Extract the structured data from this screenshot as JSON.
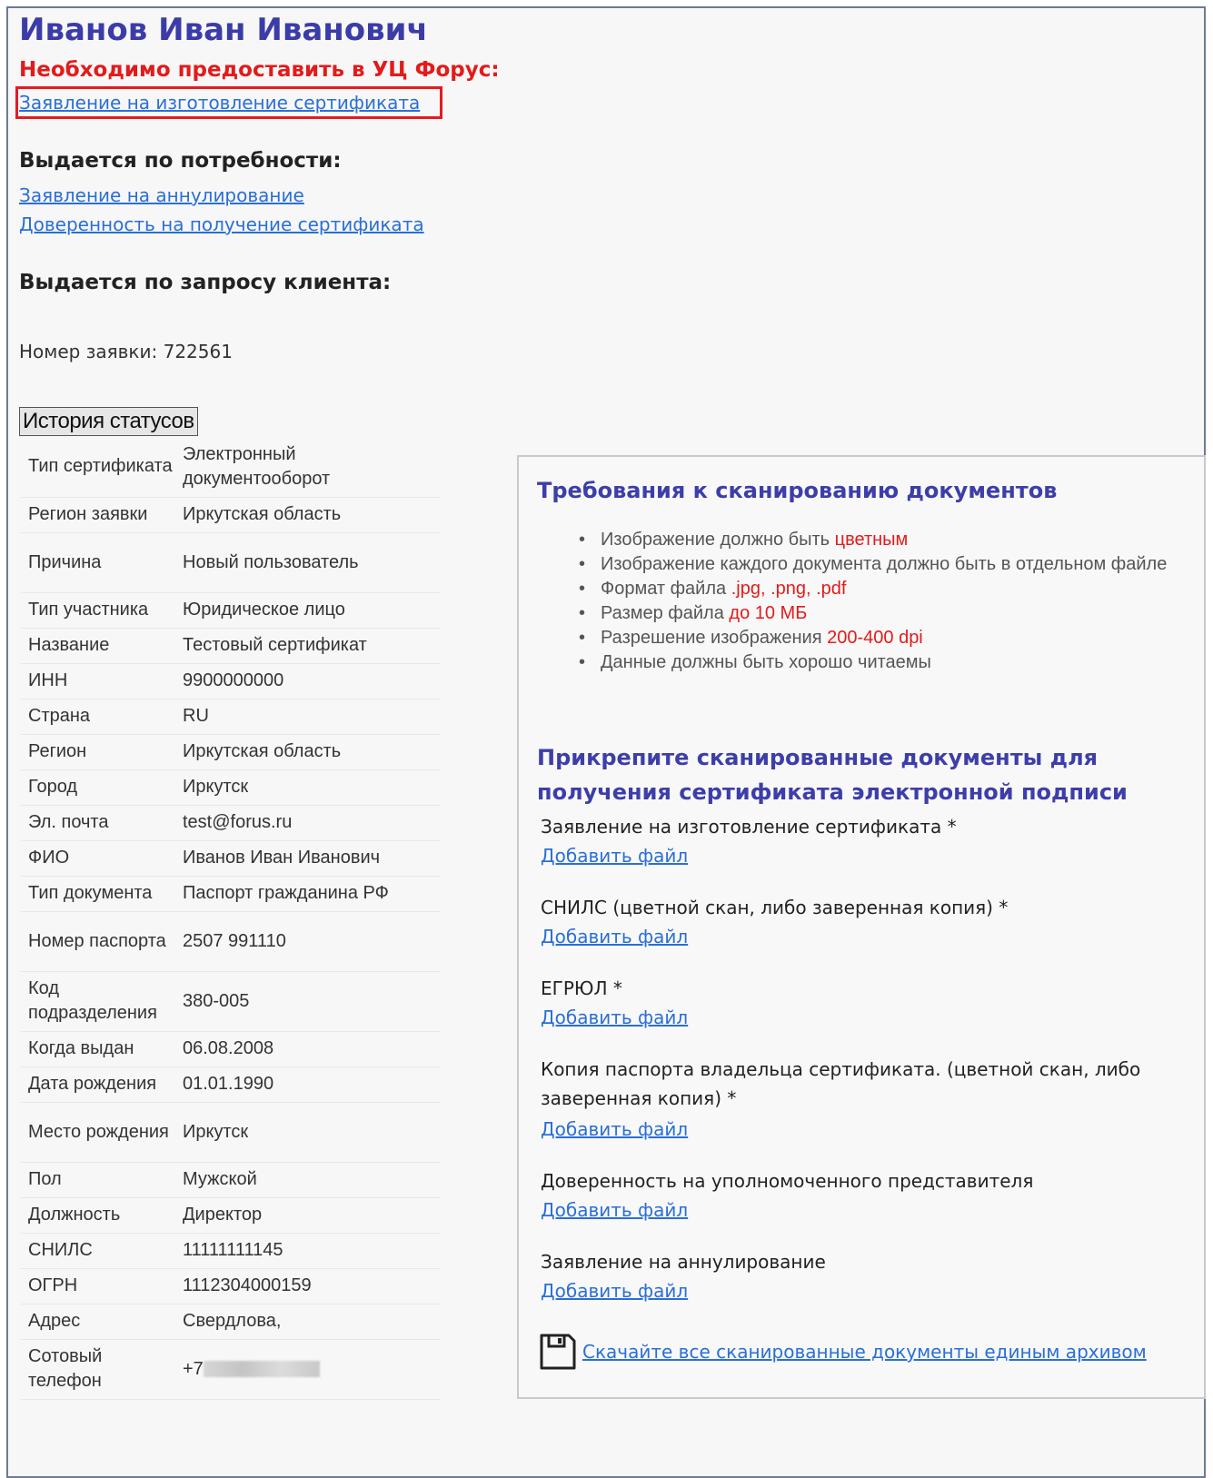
{
  "header": {
    "owner_name": "Иванов Иван Иванович",
    "required_heading": "Необходимо предоставить в УЦ Форус:",
    "required_link": "Заявление на изготовление сертификата"
  },
  "on_demand": {
    "heading": "Выдается по потребности:",
    "links": [
      "Заявление на аннулирование",
      "Доверенность на получение сертификата"
    ]
  },
  "client_request": {
    "heading": "Выдается по запросу клиента:"
  },
  "order": {
    "text": "Номер заявки: 722561"
  },
  "history_button": "История статусов",
  "details": [
    {
      "label": "Тип сертификата",
      "value": "Электронный документооборот"
    },
    {
      "label": "Регион заявки",
      "value": "Иркутская область"
    },
    {
      "label": "Причина",
      "value": "Новый пользователь"
    },
    {
      "label": "Тип участника",
      "value": "Юридическое лицо"
    },
    {
      "label": "Название",
      "value": "Тестовый сертификат"
    },
    {
      "label": "ИНН",
      "value": "9900000000"
    },
    {
      "label": "Страна",
      "value": "RU"
    },
    {
      "label": "Регион",
      "value": "Иркутская область"
    },
    {
      "label": "Город",
      "value": "Иркутск"
    },
    {
      "label": "Эл. почта",
      "value": "test@forus.ru"
    },
    {
      "label": "ФИО",
      "value": "Иванов Иван Иванович"
    },
    {
      "label": "Тип документа",
      "value": "Паспорт гражданина РФ"
    },
    {
      "label": "Номер паспорта",
      "value": "2507 991110"
    },
    {
      "label": "Код подразделения",
      "value": "380-005"
    },
    {
      "label": "Когда выдан",
      "value": "06.08.2008"
    },
    {
      "label": "Дата рождения",
      "value": "01.01.1990"
    },
    {
      "label": "Место рождения",
      "value": "Иркутск"
    },
    {
      "label": "Пол",
      "value": "Мужской"
    },
    {
      "label": "Должность",
      "value": "Директор"
    },
    {
      "label": "СНИЛС",
      "value": "11111111145"
    },
    {
      "label": "ОГРН",
      "value": "1112304000159"
    },
    {
      "label": "Адрес",
      "value": "Свердлова,"
    },
    {
      "label": "Сотовый телефон",
      "value": "+7"
    }
  ],
  "panel": {
    "title": "Требования к сканированию документов",
    "requirements": [
      {
        "text": "Изображение должно быть ",
        "highlight": "цветным"
      },
      {
        "text": "Изображение каждого документа должно быть в отдельном файле",
        "highlight": ""
      },
      {
        "text": "Формат файла ",
        "highlight": ".jpg, .png, .pdf"
      },
      {
        "text": "Размер файла ",
        "highlight": "до 10 МБ"
      },
      {
        "text": "Разрешение изображения ",
        "highlight": "200-400 dpi"
      },
      {
        "text": "Данные должны быть хорошо читаемы",
        "highlight": ""
      }
    ],
    "attach_title": "Прикрепите сканированные документы для получения сертификата электронной подписи",
    "add_file_label": "Добавить файл",
    "documents": [
      "Заявление на изготовление сертификата *",
      "СНИЛС (цветной скан, либо заверенная копия) *",
      "ЕГРЮЛ *",
      "Копия паспорта владельца сертификата. (цветной скан, либо заверенная копия) *",
      "Доверенность на уполномоченного представителя",
      "Заявление на аннулирование"
    ],
    "archive_link": "Скачайте все сканированные документы единым архивом"
  },
  "icons": {
    "download_archive": "floppy-disk-icon"
  },
  "colors": {
    "name_blue": "#3b3ca8",
    "required_red": "#e21b1b",
    "link_blue": "#2a6fd6",
    "highlight_frame": "#e31b23"
  }
}
